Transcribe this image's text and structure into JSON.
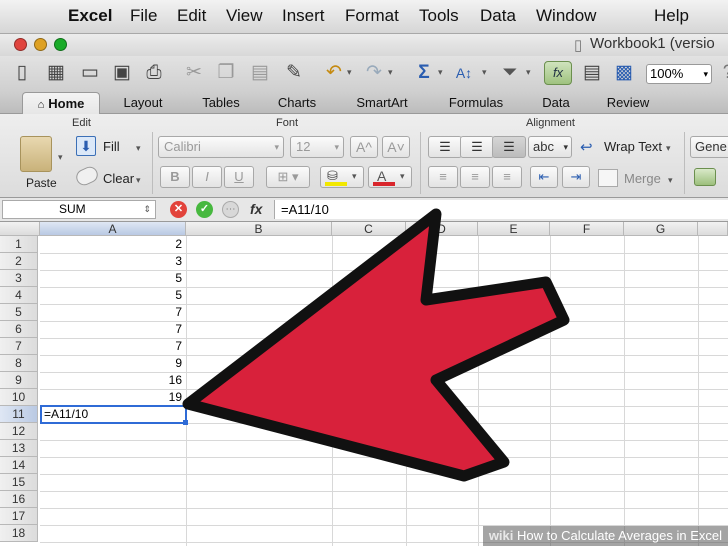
{
  "menubar": {
    "apple": "",
    "app": "Excel",
    "items": [
      "File",
      "Edit",
      "View",
      "Insert",
      "Format",
      "Tools",
      "Data",
      "Window",
      "",
      "Help"
    ]
  },
  "window": {
    "title": "Workbook1 (versio"
  },
  "toolbar": {
    "zoom": "100%"
  },
  "ribbon": {
    "tabs": [
      "Home",
      "Layout",
      "Tables",
      "Charts",
      "SmartArt",
      "Formulas",
      "Data",
      "Review"
    ],
    "groups": {
      "edit": "Edit",
      "font": "Font",
      "alignment": "Alignment"
    },
    "paste": "Paste",
    "fill": "Fill",
    "clear": "Clear",
    "font_name": "Calibri",
    "font_size": "12",
    "bold": "B",
    "italic": "I",
    "underline": "U",
    "abc": "abc",
    "wrap_text": "Wrap Text",
    "merge": "Merge",
    "number_format": "Gene"
  },
  "formula": {
    "name_box": "SUM",
    "fx": "fx",
    "content": "=A11/10"
  },
  "grid": {
    "columns": [
      "A",
      "B",
      "C",
      "D",
      "E",
      "F",
      "G"
    ],
    "rows": [
      "1",
      "2",
      "3",
      "4",
      "5",
      "6",
      "7",
      "8",
      "9",
      "10",
      "11",
      "12",
      "13",
      "14",
      "15",
      "16",
      "17",
      "18"
    ],
    "colA": [
      "2",
      "3",
      "5",
      "5",
      "7",
      "7",
      "7",
      "9",
      "16",
      "19"
    ],
    "active_cell": "A11",
    "editing": "=A11/10"
  },
  "watermark": {
    "brand": "wiki",
    "text": "How to Calculate Averages in Excel"
  },
  "colors": {
    "arrow": "#d8213b",
    "arrow_outline": "#111111",
    "active": "#2f6bd6"
  }
}
